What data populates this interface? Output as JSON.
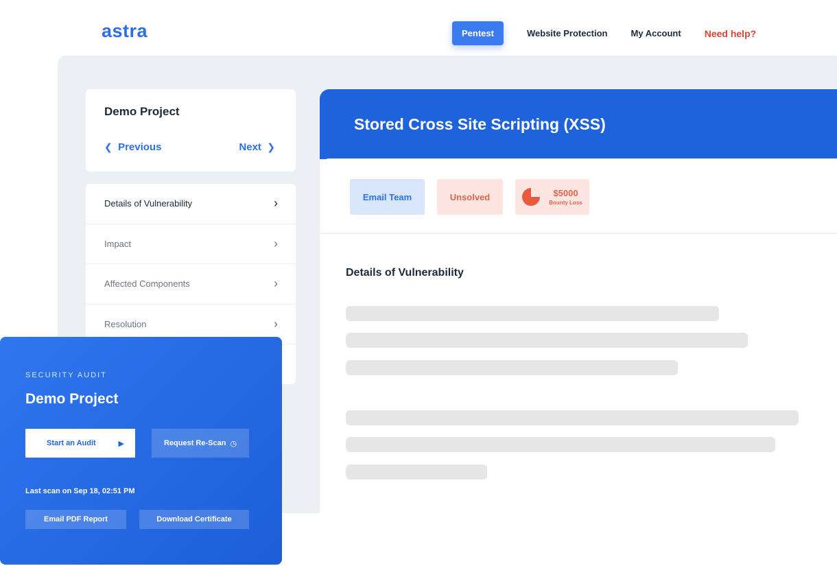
{
  "brand": {
    "logo": "astra",
    "accent": "#2d6fe6"
  },
  "nav": {
    "pentest": "Pentest",
    "website_protection": "Website Protection",
    "my_account": "My Account",
    "need_help": "Need help?"
  },
  "project_card": {
    "title": "Demo Project",
    "previous": "Previous",
    "next": "Next",
    "prev_icon": "chevron-left-icon",
    "next_icon": "chevron-right-icon"
  },
  "menu": {
    "items": [
      {
        "label": "Details of Vulnerability",
        "active": true
      },
      {
        "label": "Impact",
        "active": false
      },
      {
        "label": "Affected Components",
        "active": false
      },
      {
        "label": "Resolution",
        "active": false
      }
    ]
  },
  "vulnerability": {
    "title": "Stored Cross Site Scripting (XSS)",
    "badges": {
      "email_team": "Email Team",
      "status": "Unsolved",
      "bounty_amount": "$5000",
      "bounty_label": "Bounty Loss",
      "bounty_icon": "pie-chart-icon"
    },
    "section_title": "Details of Vulnerability"
  },
  "audit_card": {
    "eyebrow": "SECURITY AUDIT",
    "project": "Demo Project",
    "start_audit": "Start an Audit",
    "request_rescan": "Request Re-Scan",
    "last_scan": "Last scan on Sep 18, 02:51 PM",
    "email_pdf": "Email PDF Report",
    "download_certificate": "Download Certificate",
    "play_icon": "play-icon",
    "clock_icon": "clock-icon"
  },
  "colors": {
    "header_blue": "#1f63dc",
    "danger": "#d9442e",
    "panel_grey": "#eceff4"
  }
}
